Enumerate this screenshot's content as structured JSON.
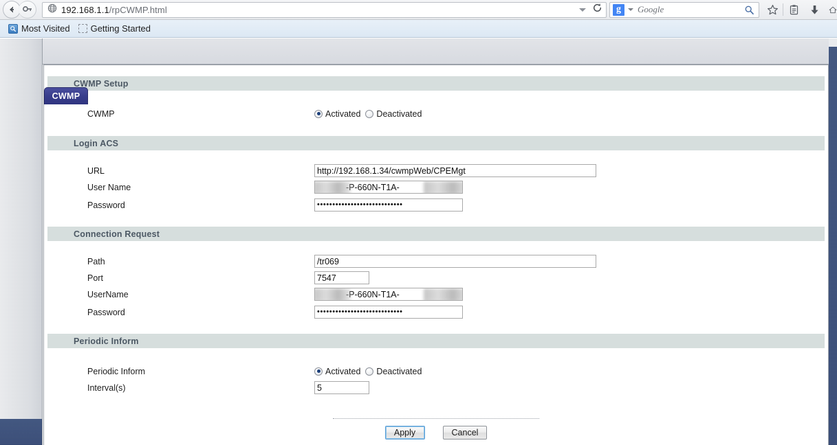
{
  "browser": {
    "back_icon": "back-arrow-icon",
    "forward_icon": "forward-arrow-icon",
    "site_icon": "globe-icon",
    "url_host": "192.168.1.1",
    "url_path": "/rpCWMP.html",
    "url_dropdown_icon": "caret-down-icon",
    "reload_icon": "reload-icon",
    "search": {
      "engine_label": "Google",
      "engine_logo": "google-g-logo",
      "engine_dropdown_icon": "caret-down-icon",
      "submit_icon": "magnifier-icon"
    },
    "toolbar_icons": [
      "star-icon",
      "reading-list-icon",
      "download-icon",
      "home-icon"
    ]
  },
  "bookmarks": {
    "items": [
      {
        "label": "Most Visited",
        "icon": "most-visited-icon"
      },
      {
        "label": "Getting Started",
        "icon": "getting-started-icon"
      }
    ]
  },
  "page": {
    "tab_label": "CWMP",
    "sections": {
      "cwmp_setup": {
        "heading": "CWMP Setup",
        "cwmp_label": "CWMP",
        "radio_activated": "Activated",
        "radio_deactivated": "Deactivated",
        "selected": "Activated"
      },
      "login_acs": {
        "heading": "Login ACS",
        "url_label": "URL",
        "url_value": "http://192.168.1.34/cwmpWeb/CPEMgt",
        "username_label": "User Name",
        "username_value": "-P-660N-T1A-",
        "password_label": "Password",
        "password_mask": "••••••••••••••••••••••••••••"
      },
      "connection_request": {
        "heading": "Connection Request",
        "path_label": "Path",
        "path_value": "/tr069",
        "port_label": "Port",
        "port_value": "7547",
        "username_label": "UserName",
        "username_value": "-P-660N-T1A-",
        "password_label": "Password",
        "password_mask": "••••••••••••••••••••••••••••"
      },
      "periodic_inform": {
        "heading": "Periodic Inform",
        "inform_label": "Periodic Inform",
        "radio_activated": "Activated",
        "radio_deactivated": "Deactivated",
        "selected": "Activated",
        "interval_label": "Interval(s)",
        "interval_value": "5"
      }
    },
    "buttons": {
      "apply": "Apply",
      "cancel": "Cancel"
    }
  },
  "colors": {
    "tab_blue": "#393e8c",
    "section_header_bg": "#d6dedd",
    "section_header_text": "#4c5864",
    "radio_dot": "#1c3f7a",
    "rail_navy": "#3b5383"
  }
}
